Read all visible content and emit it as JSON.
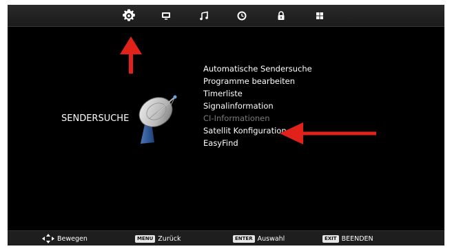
{
  "tabs": [
    {
      "icon": "gear-icon",
      "active": true
    },
    {
      "icon": "monitor-icon",
      "active": false
    },
    {
      "icon": "music-note-icon",
      "active": false
    },
    {
      "icon": "clock-icon",
      "active": false
    },
    {
      "icon": "lock-icon",
      "active": false
    },
    {
      "icon": "grid-icon",
      "active": false
    }
  ],
  "section": {
    "title": "SENDERSUCHE",
    "icon": "satellite-dish-icon"
  },
  "menu": {
    "items": [
      {
        "label": "Automatische Sendersuche",
        "enabled": true
      },
      {
        "label": "Programme bearbeiten",
        "enabled": true
      },
      {
        "label": "Timerliste",
        "enabled": true
      },
      {
        "label": "Signalinformation",
        "enabled": true
      },
      {
        "label": "CI-Informationen",
        "enabled": false
      },
      {
        "label": "Satellit Konfiguration",
        "enabled": true
      },
      {
        "label": "EasyFind",
        "enabled": true
      }
    ]
  },
  "footer": {
    "move": {
      "icon": "dpad-arrows-icon",
      "label": "Bewegen"
    },
    "back": {
      "key": "MENU",
      "label": "Zurück"
    },
    "select": {
      "key": "ENTER",
      "label": "Auswahl"
    },
    "exit": {
      "key": "EXIT",
      "label": "BEENDEN"
    }
  },
  "colors": {
    "background": "#000000",
    "text": "#ffffff",
    "disabled_text": "#7a7a7a",
    "annotation_arrow": "#e0221b"
  }
}
